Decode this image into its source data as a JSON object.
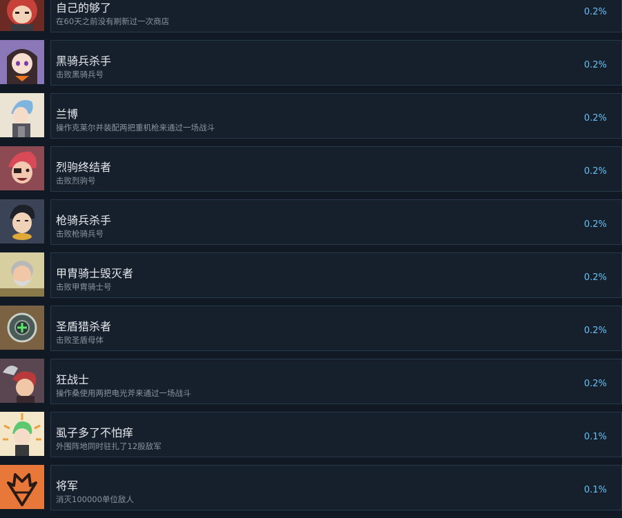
{
  "colors": {
    "background": "#111a24",
    "card": "#16202d",
    "accent": "#66c0f4"
  },
  "achievements": [
    {
      "title": "自己的够了",
      "desc": "在60天之前没有刷新过一次商店",
      "pct": "0.2%",
      "icon": "red-haired-girl-icon"
    },
    {
      "title": "黑骑兵杀手",
      "desc": "击败黑骑兵号",
      "pct": "0.2%",
      "icon": "purple-haired-girl-icon"
    },
    {
      "title": "兰博",
      "desc": "操作克莱尔并装配两把重机枪来通过一场战斗",
      "pct": "0.2%",
      "icon": "blue-haired-soldier-icon"
    },
    {
      "title": "烈驹终结者",
      "desc": "击败烈驹号",
      "pct": "0.2%",
      "icon": "eyepatch-warrior-icon"
    },
    {
      "title": "枪骑兵杀手",
      "desc": "击败枪骑兵号",
      "pct": "0.2%",
      "icon": "dark-haired-man-icon"
    },
    {
      "title": "甲胄骑士毁灭者",
      "desc": "击败甲胄骑士号",
      "pct": "0.2%",
      "icon": "bearded-old-man-icon"
    },
    {
      "title": "圣盾猎杀者",
      "desc": "击败圣盾母体",
      "pct": "0.2%",
      "icon": "holy-shield-icon"
    },
    {
      "title": "狂战士",
      "desc": "操作桑使用两把电光斧来通过一场战斗",
      "pct": "0.2%",
      "icon": "axe-berserker-icon"
    },
    {
      "title": "虱子多了不怕痒",
      "desc": "外围阵地同时驻扎了12股敌军",
      "pct": "0.1%",
      "icon": "green-haired-boy-icon"
    },
    {
      "title": "将军",
      "desc": "消灭100000单位敌人",
      "pct": "0.1%",
      "icon": "general-emblem-icon"
    }
  ]
}
